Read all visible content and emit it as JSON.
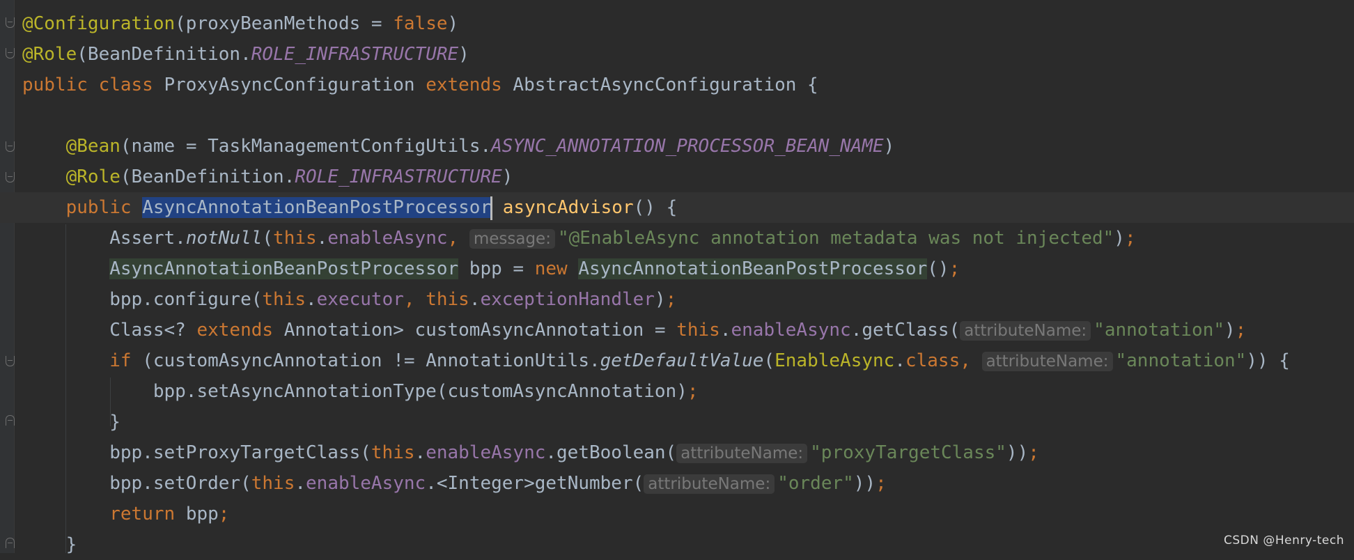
{
  "editor": {
    "lines": [
      {
        "tokens": [
          {
            "t": "@Configuration",
            "c": "ann"
          },
          {
            "t": "(proxyBeanMethods = "
          },
          {
            "t": "false",
            "c": "kw"
          },
          {
            "t": ")"
          }
        ]
      },
      {
        "tokens": [
          {
            "t": "@Role",
            "c": "ann"
          },
          {
            "t": "(BeanDefinition."
          },
          {
            "t": "ROLE_INFRASTRUCTURE",
            "c": "cst"
          },
          {
            "t": ")"
          }
        ]
      },
      {
        "tokens": [
          {
            "t": "public class ",
            "c": "kw"
          },
          {
            "t": "ProxyAsyncConfiguration "
          },
          {
            "t": "extends ",
            "c": "kw"
          },
          {
            "t": "AbstractAsyncConfiguration {"
          }
        ]
      },
      {
        "tokens": []
      },
      {
        "tokens": [
          {
            "t": "    "
          },
          {
            "t": "@Bean",
            "c": "ann"
          },
          {
            "t": "(name = TaskManagementConfigUtils."
          },
          {
            "t": "ASYNC_ANNOTATION_PROCESSOR_BEAN_NAME",
            "c": "cst"
          },
          {
            "t": ")"
          }
        ]
      },
      {
        "tokens": [
          {
            "t": "    "
          },
          {
            "t": "@Role",
            "c": "ann"
          },
          {
            "t": "(BeanDefinition."
          },
          {
            "t": "ROLE_INFRASTRUCTURE",
            "c": "cst"
          },
          {
            "t": ")"
          }
        ]
      },
      {
        "current": true,
        "tokens": [
          {
            "t": "    "
          },
          {
            "t": "public ",
            "c": "kw"
          },
          {
            "t": "AsyncAnnotationBeanPostProcessor",
            "c": "sel"
          },
          {
            "caret": true
          },
          {
            "t": " "
          },
          {
            "t": "asyncAdvisor",
            "c": "mth"
          },
          {
            "t": "() {"
          }
        ]
      },
      {
        "tokens": [
          {
            "t": "        Assert."
          },
          {
            "t": "notNull",
            "c": "ita"
          },
          {
            "t": "("
          },
          {
            "t": "this",
            "c": "kw"
          },
          {
            "t": "."
          },
          {
            "t": "enableAsync",
            "c": "fld"
          },
          {
            "t": ", ",
            "c": "kw"
          },
          {
            "t": "message:",
            "c": "hint"
          },
          {
            "t": "\"@EnableAsync annotation metadata was not injected\"",
            "c": "str"
          },
          {
            "t": ")"
          },
          {
            "t": ";",
            "c": "kw"
          }
        ]
      },
      {
        "tokens": [
          {
            "t": "        "
          },
          {
            "t": "AsyncAnnotationBeanPostProcessor",
            "c": "ref"
          },
          {
            "t": " bpp = "
          },
          {
            "t": "new ",
            "c": "kw"
          },
          {
            "t": "AsyncAnnotationBeanPostProcessor",
            "c": "ref"
          },
          {
            "t": "()"
          },
          {
            "t": ";",
            "c": "kw"
          }
        ]
      },
      {
        "tokens": [
          {
            "t": "        bpp.configure("
          },
          {
            "t": "this",
            "c": "kw"
          },
          {
            "t": "."
          },
          {
            "t": "executor",
            "c": "fld"
          },
          {
            "t": ", ",
            "c": "kw"
          },
          {
            "t": "this",
            "c": "kw"
          },
          {
            "t": "."
          },
          {
            "t": "exceptionHandler",
            "c": "fld"
          },
          {
            "t": ")"
          },
          {
            "t": ";",
            "c": "kw"
          }
        ]
      },
      {
        "tokens": [
          {
            "t": "        Class<? "
          },
          {
            "t": "extends ",
            "c": "kw"
          },
          {
            "t": "Annotation> customAsyncAnnotation = "
          },
          {
            "t": "this",
            "c": "kw"
          },
          {
            "t": "."
          },
          {
            "t": "enableAsync",
            "c": "fld"
          },
          {
            "t": ".getClass("
          },
          {
            "t": "attributeName:",
            "c": "hint"
          },
          {
            "t": "\"annotation\"",
            "c": "str"
          },
          {
            "t": ")"
          },
          {
            "t": ";",
            "c": "kw"
          }
        ]
      },
      {
        "tokens": [
          {
            "t": "        "
          },
          {
            "t": "if ",
            "c": "kw"
          },
          {
            "t": "(customAsyncAnnotation != AnnotationUtils."
          },
          {
            "t": "getDefaultValue",
            "c": "ita"
          },
          {
            "t": "("
          },
          {
            "t": "EnableAsync",
            "c": "ann"
          },
          {
            "t": "."
          },
          {
            "t": "class",
            "c": "kw"
          },
          {
            "t": ", ",
            "c": "kw"
          },
          {
            "t": "attributeName:",
            "c": "hint"
          },
          {
            "t": "\"annotation\"",
            "c": "str"
          },
          {
            "t": ")) {"
          }
        ]
      },
      {
        "tokens": [
          {
            "t": "            bpp.setAsyncAnnotationType(customAsyncAnnotation)"
          },
          {
            "t": ";",
            "c": "kw"
          }
        ]
      },
      {
        "tokens": [
          {
            "t": "        }"
          }
        ]
      },
      {
        "tokens": [
          {
            "t": "        bpp.setProxyTargetClass("
          },
          {
            "t": "this",
            "c": "kw"
          },
          {
            "t": "."
          },
          {
            "t": "enableAsync",
            "c": "fld"
          },
          {
            "t": ".getBoolean("
          },
          {
            "t": "attributeName:",
            "c": "hint"
          },
          {
            "t": "\"proxyTargetClass\"",
            "c": "str"
          },
          {
            "t": "))"
          },
          {
            "t": ";",
            "c": "kw"
          }
        ]
      },
      {
        "tokens": [
          {
            "t": "        bpp.setOrder("
          },
          {
            "t": "this",
            "c": "kw"
          },
          {
            "t": "."
          },
          {
            "t": "enableAsync",
            "c": "fld"
          },
          {
            "t": ".<Integer>getNumber("
          },
          {
            "t": "attributeName:",
            "c": "hint"
          },
          {
            "t": "\"order\"",
            "c": "str"
          },
          {
            "t": "))"
          },
          {
            "t": ";",
            "c": "kw"
          }
        ]
      },
      {
        "tokens": [
          {
            "t": "        "
          },
          {
            "t": "return ",
            "c": "kw"
          },
          {
            "t": "bpp"
          },
          {
            "t": ";",
            "c": "kw"
          }
        ]
      },
      {
        "tokens": [
          {
            "t": "    }"
          }
        ]
      }
    ]
  },
  "watermark": "CSDN @Henry-tech",
  "colors": {
    "background": "#2b2b2b",
    "keyword": "#cc7832",
    "annotation": "#bbb529",
    "string": "#6a8759",
    "constant": "#9876aa",
    "method": "#ffc66d",
    "selection": "#214283"
  }
}
